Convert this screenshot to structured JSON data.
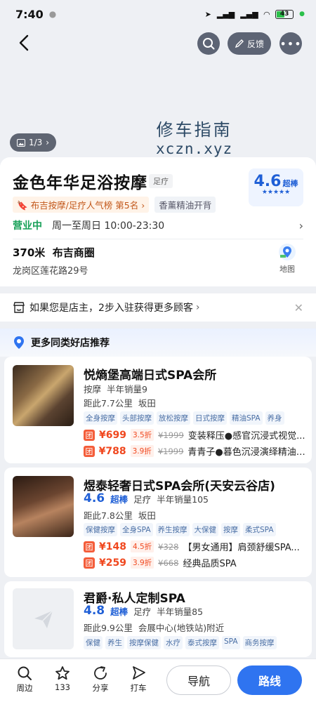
{
  "status_bar": {
    "time": "7:40",
    "battery": "43"
  },
  "top_nav": {
    "feedback_label": "反馈",
    "more_label": "•••"
  },
  "watermark": {
    "cn": "修车指南",
    "en": "xczn.xyz"
  },
  "photo_counter": "1/3",
  "shop": {
    "name": "金色年华足浴按摩",
    "category": "足疗",
    "rating": "4.6",
    "rating_level": "超棒",
    "rank_tag": "布吉按摩/足疗人气榜 第5名",
    "feature_tag": "香薰精油开背",
    "open_status": "营业中",
    "hours": "周一至周日 10:00-23:30",
    "distance": "370米",
    "area": "布吉商圈",
    "address": "龙岗区莲花路29号",
    "map_label": "地图"
  },
  "claim_banner": {
    "text": "如果您是店主，2步入驻获得更多顾客"
  },
  "recommend": {
    "title": "更多同类好店推荐",
    "items": [
      {
        "name": "悦熵堡高端日式SPA会所",
        "category": "按摩",
        "sales": "半年销量9",
        "distance": "距此7.7公里",
        "area": "坂田",
        "tags": [
          "全身按摩",
          "头部按摩",
          "放松按摩",
          "日式按摩",
          "精油SPA",
          "养身"
        ],
        "deals": [
          {
            "price": "¥699",
            "discount": "3.5折",
            "original": "¥1999",
            "title": "变装释压●感官沉浸式视觉..."
          },
          {
            "price": "¥788",
            "discount": "3.9折",
            "original": "¥1999",
            "title": "青青子●暮色沉浸演绎精油s..."
          }
        ]
      },
      {
        "name": "煜泰轻奢日式SPA会所(天安云谷店)",
        "rating": "4.6",
        "rating_level": "超棒",
        "category": "足疗",
        "sales": "半年销量105",
        "distance": "距此7.8公里",
        "area": "坂田",
        "tags": [
          "保健按摩",
          "全身SPA",
          "养生按摩",
          "大保健",
          "按摩",
          "柔式SPA"
        ],
        "deals": [
          {
            "price": "¥148",
            "discount": "4.5折",
            "original": "¥328",
            "title": "【男女通用】肩颈舒缓SPA..."
          },
          {
            "price": "¥259",
            "discount": "3.9折",
            "original": "¥668",
            "title": "经典品质SPA"
          }
        ]
      },
      {
        "name": "君爵·私人定制SPA",
        "rating": "4.8",
        "rating_level": "超棒",
        "category": "足疗",
        "sales": "半年销量85",
        "distance": "距此9.9公里",
        "area": "会展中心(地铁站)附近",
        "tags": [
          "保健",
          "养生",
          "按摩保健",
          "水疗",
          "泰式按摩",
          "SPA",
          "商务按摩"
        ]
      }
    ]
  },
  "tuan_label": "团",
  "bottom_bar": {
    "nearby": "周边",
    "favorites_count": "133",
    "share": "分享",
    "taxi": "打车",
    "navigate": "导航",
    "route": "路线"
  }
}
